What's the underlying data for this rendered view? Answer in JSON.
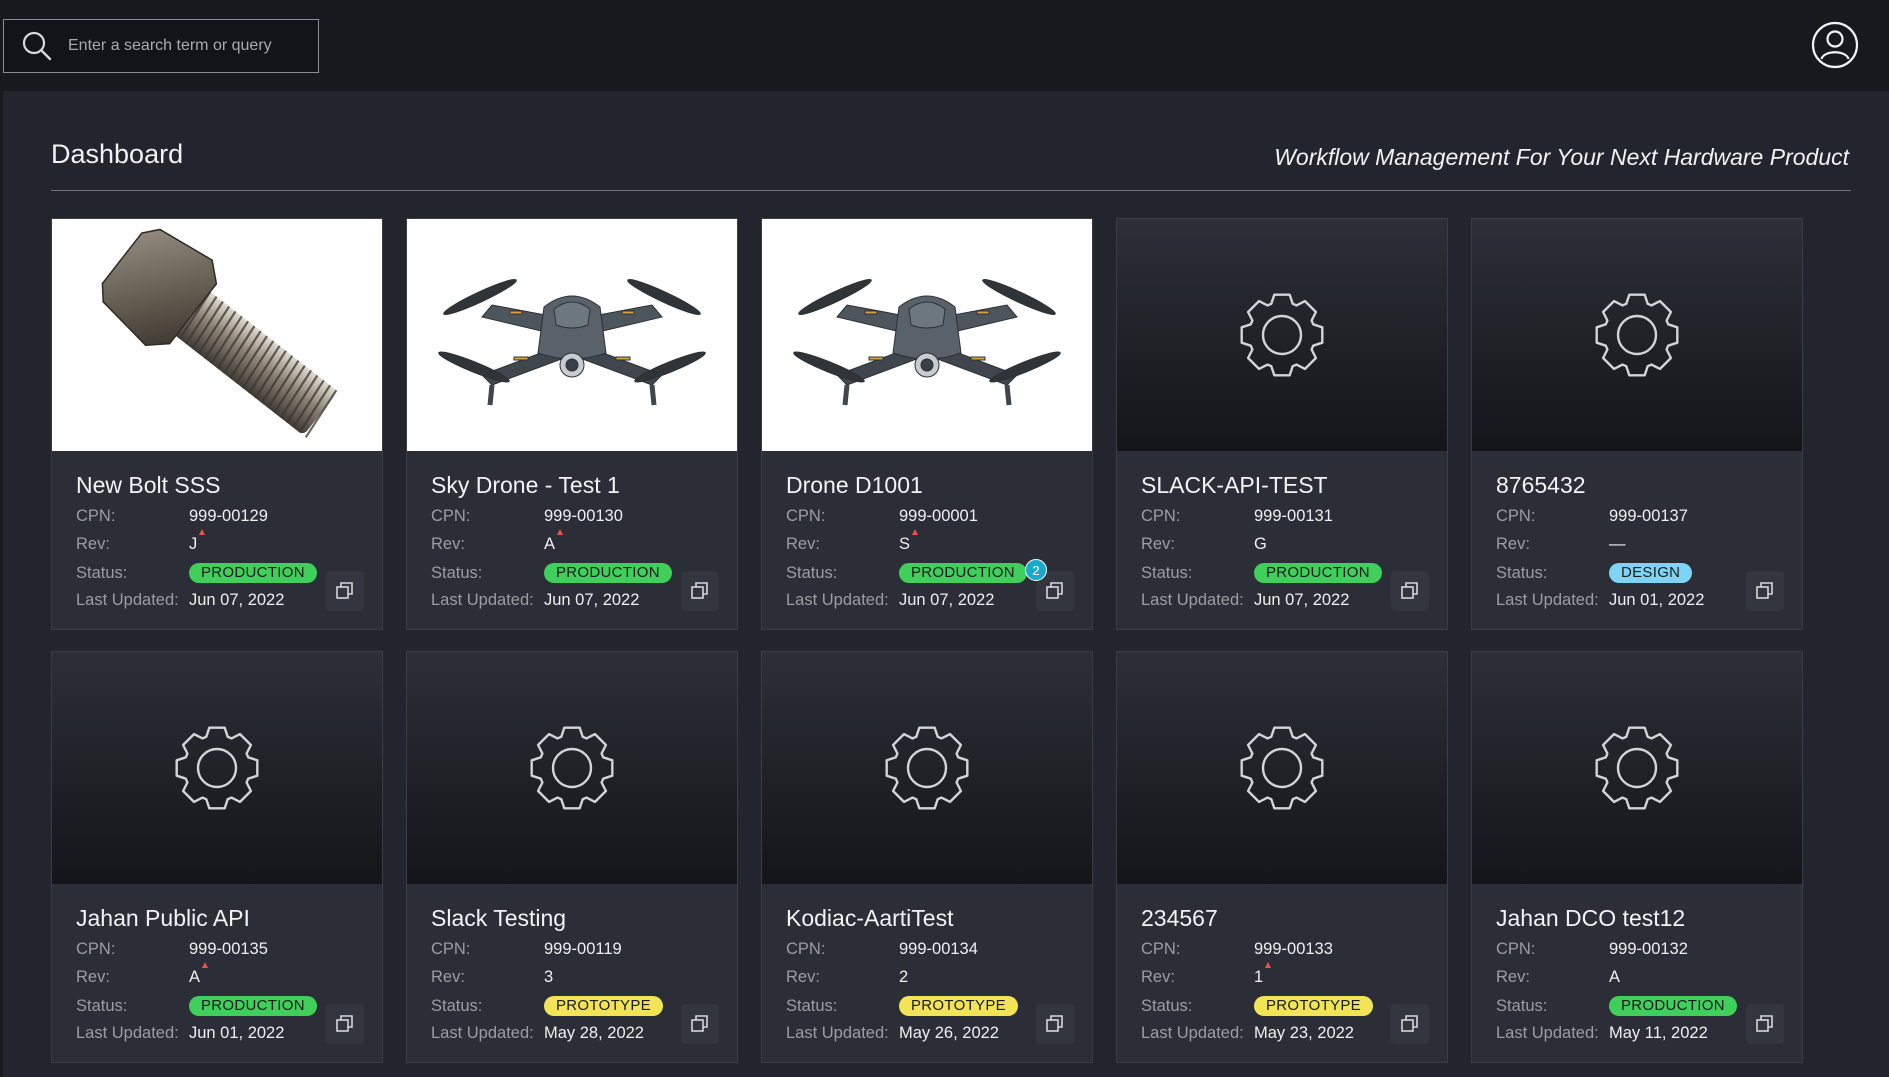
{
  "search": {
    "placeholder": "Enter a search term or query"
  },
  "header": {
    "title": "Dashboard",
    "tagline": "Workflow Management For Your Next Hardware Product"
  },
  "labels": {
    "cpn": "CPN:",
    "rev": "Rev:",
    "status": "Status:",
    "updated": "Last Updated:"
  },
  "colors": {
    "production": "#3fcf5a",
    "prototype": "#f2e456",
    "design": "#7fd4f4",
    "background": "#22252d",
    "topbar": "#17191e"
  },
  "cards": [
    {
      "name": "New Bolt SSS",
      "cpn": "999-00129",
      "rev": "J",
      "rev_flag": true,
      "status": "PRODUCTION",
      "updated": "Jun 07, 2022",
      "image": "bolt"
    },
    {
      "name": "Sky Drone - Test 1",
      "cpn": "999-00130",
      "rev": "A",
      "rev_flag": true,
      "status": "PRODUCTION",
      "updated": "Jun 07, 2022",
      "image": "drone"
    },
    {
      "name": "Drone D1001",
      "cpn": "999-00001",
      "rev": "S",
      "rev_flag": true,
      "status": "PRODUCTION",
      "updated": "Jun 07, 2022",
      "image": "drone",
      "notification_count": "2"
    },
    {
      "name": "SLACK-API-TEST",
      "cpn": "999-00131",
      "rev": "G",
      "rev_flag": false,
      "status": "PRODUCTION",
      "updated": "Jun 07, 2022",
      "image": "gear"
    },
    {
      "name": "8765432",
      "cpn": "999-00137",
      "rev": "—",
      "rev_flag": false,
      "status": "DESIGN",
      "updated": "Jun 01, 2022",
      "image": "gear"
    },
    {
      "name": "Jahan Public API",
      "cpn": "999-00135",
      "rev": "A",
      "rev_flag": true,
      "status": "PRODUCTION",
      "updated": "Jun 01, 2022",
      "image": "gear"
    },
    {
      "name": "Slack Testing",
      "cpn": "999-00119",
      "rev": "3",
      "rev_flag": false,
      "status": "PROTOTYPE",
      "updated": "May 28, 2022",
      "image": "gear"
    },
    {
      "name": "Kodiac-AartiTest",
      "cpn": "999-00134",
      "rev": "2",
      "rev_flag": false,
      "status": "PROTOTYPE",
      "updated": "May 26, 2022",
      "image": "gear"
    },
    {
      "name": "234567",
      "cpn": "999-00133",
      "rev": "1",
      "rev_flag": true,
      "status": "PROTOTYPE",
      "updated": "May 23, 2022",
      "image": "gear"
    },
    {
      "name": "Jahan DCO test12",
      "cpn": "999-00132",
      "rev": "A",
      "rev_flag": false,
      "status": "PRODUCTION",
      "updated": "May 11, 2022",
      "image": "gear"
    }
  ]
}
